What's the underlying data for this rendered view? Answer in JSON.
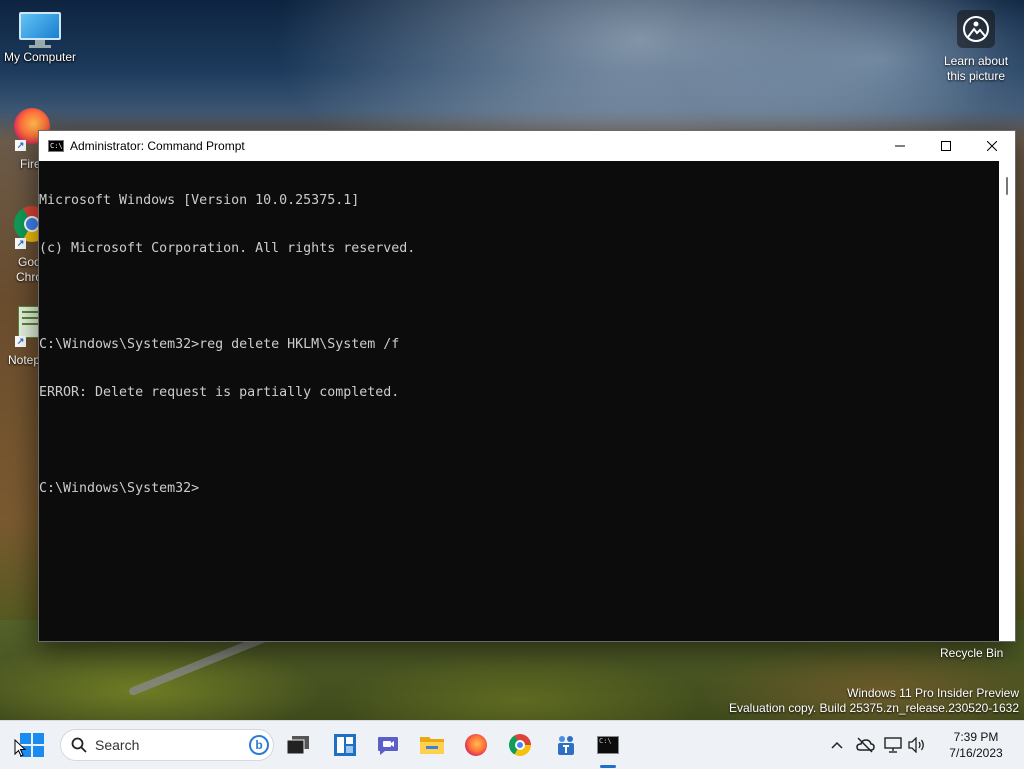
{
  "desktop": {
    "icons": {
      "my_computer": "My Computer",
      "firefox": "Firef",
      "chrome_1": "Goo",
      "chrome_2": "Chro",
      "notepad": "Notep"
    },
    "learn": {
      "line1": "Learn about",
      "line2": "this picture"
    },
    "recycle_bin": "Recycle Bin",
    "watermark": {
      "line1": "Windows 11 Pro Insider Preview",
      "line2": "Evaluation copy. Build 25375.zn_release.230520-1632"
    }
  },
  "window": {
    "title": "Administrator:  Command Prompt",
    "icon_text": "C:\\",
    "console_lines": [
      "Microsoft Windows [Version 10.0.25375.1]",
      "(c) Microsoft Corporation. All rights reserved.",
      "",
      "C:\\Windows\\System32>reg delete HKLM\\System /f",
      "ERROR: Delete request is partially completed.",
      "",
      "C:\\Windows\\System32>"
    ],
    "colors": {
      "console_bg": "#0c0c0c",
      "console_fg": "#cccccc",
      "titlebar": "#ffffff"
    }
  },
  "taskbar": {
    "search_placeholder": "Search",
    "apps": [
      "start-icon",
      "search-icon",
      "bing-icon",
      "task-view-icon",
      "widgets-icon",
      "chat-icon",
      "file-explorer-icon",
      "firefox-icon",
      "chrome-icon",
      "teams-icon",
      "cmd-icon"
    ],
    "clock": {
      "time": "7:39 PM",
      "date": "7/16/2023"
    },
    "tray": [
      "chevron-up-icon",
      "onedrive-icon",
      "network-icon",
      "volume-icon"
    ],
    "accent": "#1a73c9"
  }
}
